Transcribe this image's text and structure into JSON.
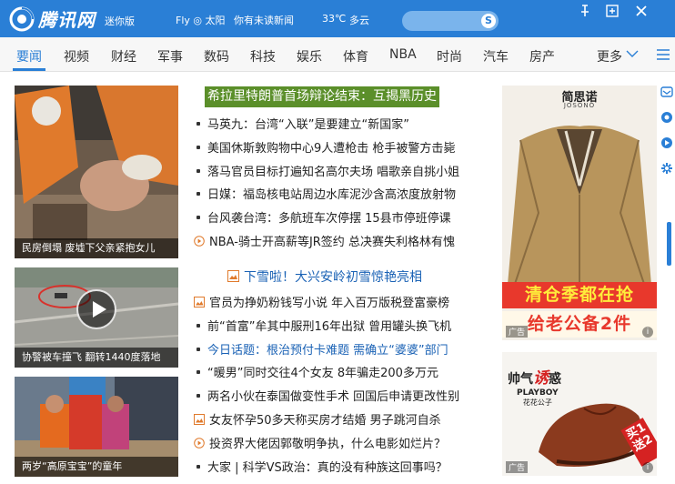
{
  "titlebar": {
    "logo_text": "腾讯网",
    "mini_badge": "迷你版",
    "weather_user": "Fly ◎ 太阳",
    "news_notice": "你有未读新闻",
    "temperature": "33℃",
    "weather_desc": "多云",
    "search_icon_glyph": "S",
    "brand_color": "#2a7fd6"
  },
  "nav": {
    "items": [
      "要闻",
      "视频",
      "财经",
      "军事",
      "数码",
      "科技",
      "娱乐",
      "体育",
      "NBA",
      "时尚",
      "汽车",
      "房产"
    ],
    "active_index": 0,
    "more_label": "更多"
  },
  "photos": [
    {
      "caption": "民房倒塌 废墟下父亲紧抱女儿"
    },
    {
      "caption": "协警被车撞飞 翻转1440度落地"
    },
    {
      "caption": "两岁“高原宝宝”的童年"
    }
  ],
  "headlines": {
    "lead": "希拉里特朗普首场辩论结束：互揭黑历史",
    "group1": [
      {
        "text": "马英九：台湾“入联”是要建立“新国家”",
        "icon": "dot"
      },
      {
        "text": "美国休斯敦购物中心9人遭枪击 枪手被警方击毙",
        "icon": "dot"
      },
      {
        "text": "落马官员目标打遍知名高尔夫场 唱歌亲自挑小姐",
        "icon": "dot"
      },
      {
        "text": "日媒：福岛核电站周边水库泥沙含高浓度放射物",
        "icon": "dot"
      },
      {
        "text": "台风袭台湾：多航班车次停摆 15县市停班停课",
        "icon": "dot"
      },
      {
        "text": "NBA-骑士开高薪等JR签约 总决赛失利格林有愧",
        "icon": "video"
      }
    ],
    "section2_title": "下雪啦！大兴安岭初雪惊艳亮相",
    "group2": [
      {
        "text": "官员为挣奶粉钱写小说 年入百万版税登富豪榜",
        "icon": "photo",
        "style": "normal"
      },
      {
        "text": "前“首富”牟其中服刑16年出狱 曾用罐头换飞机",
        "icon": "dot",
        "style": "normal"
      },
      {
        "text": "今日话题：根治预付卡难题 需确立“婆婆”部门",
        "icon": "dot",
        "style": "blue"
      },
      {
        "text": "“暖男”同时交往4个女友 8年骗走200多万元",
        "icon": "dot",
        "style": "normal"
      },
      {
        "text": "两名小伙在泰国做变性手术 回国后申请更改性别",
        "icon": "dot",
        "style": "normal"
      },
      {
        "text": "女友怀孕50多天称买房才结婚 男子跳河自杀",
        "icon": "photo",
        "style": "normal"
      },
      {
        "text": "投资界大佬因郭敬明争执，什么电影如烂片？",
        "icon": "video",
        "style": "normal"
      },
      {
        "text": "大家 | 科学VS政治：真的没有种族这回事吗？",
        "icon": "dot",
        "style": "normal"
      }
    ]
  },
  "ads": {
    "ad1": {
      "brand": "简思诺",
      "brand_sub": "JOSONO",
      "banner_top": "清仓季都在抢",
      "banner_bottom": "给老公备2件",
      "tag": "广告",
      "info": "i"
    },
    "ad2": {
      "title_prefix": "帅气",
      "title_highlight": "诱",
      "title_suffix": "惑",
      "brand": "PLAYBOY",
      "brand_sub": "花花公子",
      "promo": "买1送2",
      "tag": "广告",
      "info": "i"
    }
  }
}
